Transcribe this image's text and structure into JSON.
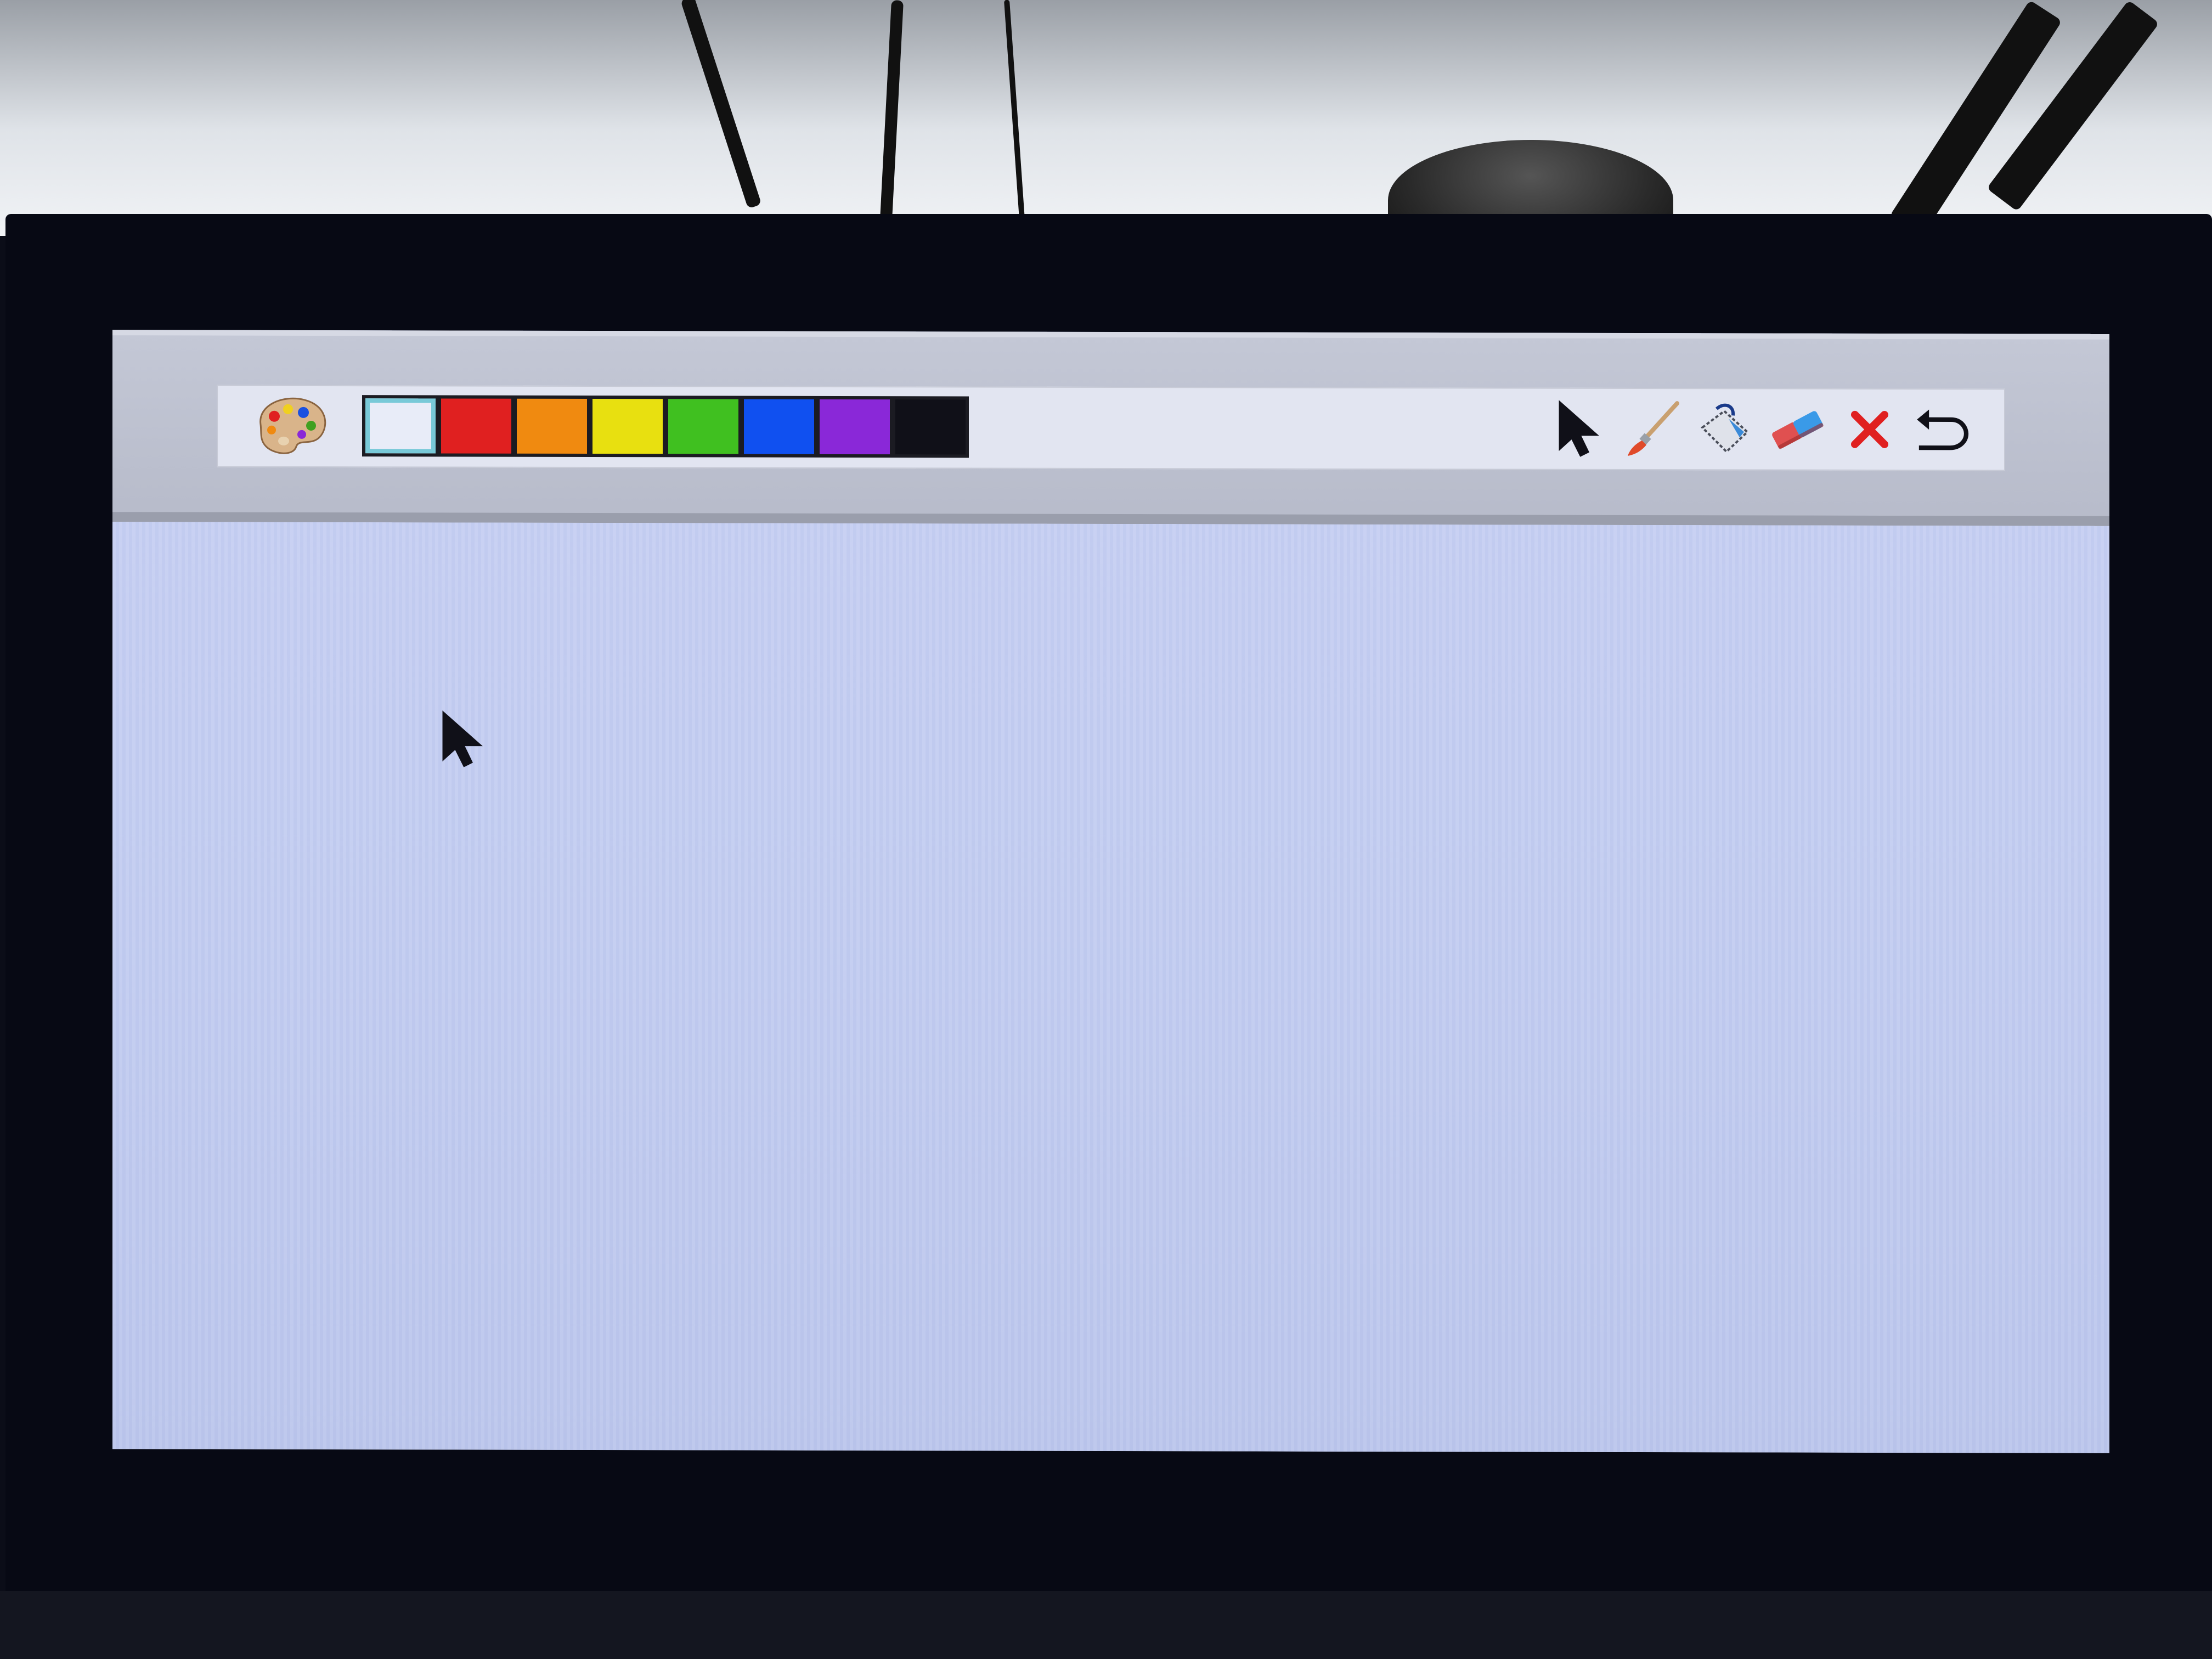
{
  "app": {
    "name": "paint-app"
  },
  "toolbar": {
    "palette_icon": "palette-icon",
    "colors": [
      {
        "name": "white",
        "hex": "#e8ecf8",
        "selected": true
      },
      {
        "name": "red",
        "hex": "#e02020"
      },
      {
        "name": "orange",
        "hex": "#f08a10"
      },
      {
        "name": "yellow",
        "hex": "#e8e010"
      },
      {
        "name": "green",
        "hex": "#40c020"
      },
      {
        "name": "blue",
        "hex": "#1050f0"
      },
      {
        "name": "purple",
        "hex": "#8a28d8"
      },
      {
        "name": "black",
        "hex": "#101018"
      }
    ],
    "tools": [
      {
        "name": "select",
        "icon": "arrow-pointer-icon"
      },
      {
        "name": "brush",
        "icon": "paintbrush-icon"
      },
      {
        "name": "fill",
        "icon": "paint-bucket-icon"
      },
      {
        "name": "eraser",
        "icon": "eraser-icon"
      },
      {
        "name": "clear",
        "icon": "close-icon",
        "color": "#e02020"
      },
      {
        "name": "undo",
        "icon": "undo-icon"
      }
    ]
  },
  "canvas": {
    "background": "#c6cff2",
    "cursor_icon": "arrow-pointer-icon"
  }
}
